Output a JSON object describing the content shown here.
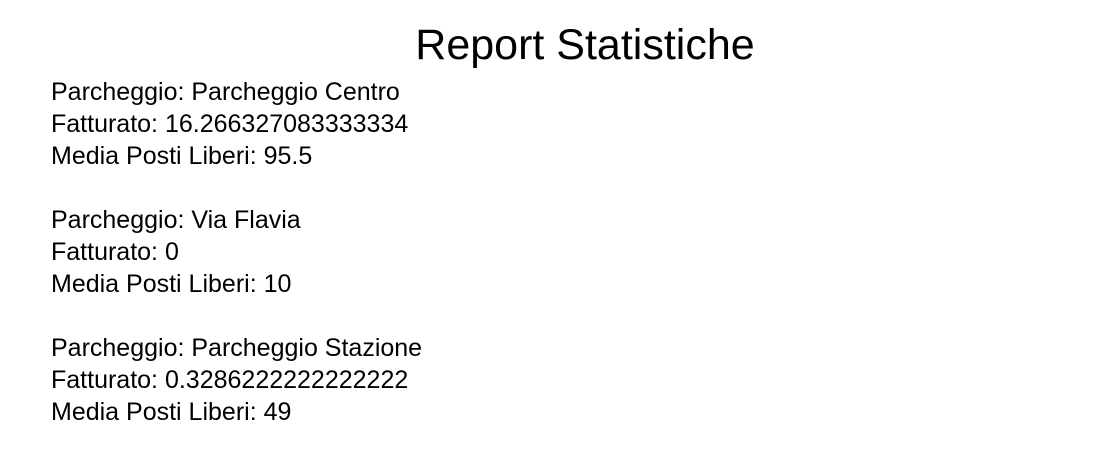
{
  "title": "Report Statistiche",
  "labels": {
    "parking": "Parcheggio: ",
    "revenue": "Fatturato: ",
    "avg_free": "Media Posti Liberi: "
  },
  "parkings": [
    {
      "name": "Parcheggio Centro",
      "revenue": "16.266327083333334",
      "avg_free_spots": "95.5"
    },
    {
      "name": "Via Flavia",
      "revenue": "0",
      "avg_free_spots": "10"
    },
    {
      "name": "Parcheggio Stazione",
      "revenue": "0.3286222222222222",
      "avg_free_spots": "49"
    }
  ]
}
